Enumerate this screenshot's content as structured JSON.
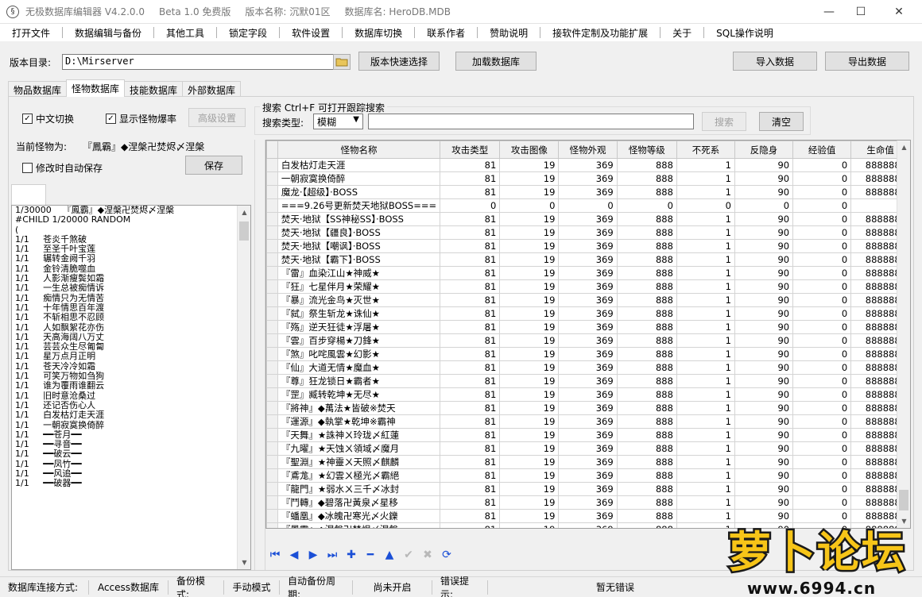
{
  "titlebar": {
    "app_name": "无极数据库编辑器 V4.2.0.0",
    "beta": "Beta 1.0 免费版",
    "version_name": "版本名称: 沉默01区",
    "db_name": "数据库名: HeroDB.MDB"
  },
  "menu": [
    "打开文件",
    "数据编辑与备份",
    "其他工具",
    "锁定字段",
    "软件设置",
    "数据库切换",
    "联系作者",
    "赞助说明",
    "接软件定制及功能扩展",
    "关于",
    "SQL操作说明"
  ],
  "toolbar": {
    "version_dir_label": "版本目录:",
    "version_dir_value": "D:\\Mirserver",
    "quick_select": "版本快速选择",
    "load_db": "加载数据库",
    "import": "导入数据",
    "export": "导出数据"
  },
  "tabs": [
    "物品数据库",
    "怪物数据库",
    "技能数据库",
    "外部数据库"
  ],
  "options": {
    "chinese_switch": "中文切换",
    "show_drop_rate": "显示怪物爆率",
    "advanced": "高级设置"
  },
  "search": {
    "title": "搜索  Ctrl+F 可打开跟踪搜索",
    "type_label": "搜索类型:",
    "type_value": "模糊",
    "query": "",
    "search_btn": "搜索",
    "clear_btn": "清空"
  },
  "current": {
    "label": "当前怪物为:",
    "name": "『鳳霸』◆涅槃卍焚烬〆涅槃",
    "autosave": "修改时自动保存",
    "save": "保存"
  },
  "droplist": [
    "",
    "1/30000    『鳳霸』◆涅槃卍焚烬〆涅槃",
    "",
    "",
    "#CHILD 1/20000 RANDOM",
    "(",
    "1/1     苍炎千煞破",
    "1/1     至圣千叶宝莲",
    "1/1     辗转金阙千羽",
    "1/1     金铃清脆噬血",
    "1/1     人影渐瘦鬓如霜",
    "1/1     一生总被痴情诉",
    "1/1     痴情只为无情苦",
    "1/1     十年情思百年渡",
    "1/1     不斩相思不忍顾",
    "1/1     人如飘絮花亦伤",
    "1/1     天高海阔八万丈",
    "1/1     芸芸众生尽匍匐",
    "1/1     星万点月正明",
    "1/1     苍天冷冷如霜",
    "1/1     可笑万物如刍狗",
    "1/1     谁为覆雨谁翻云",
    "1/1     旧时意沧桑过",
    "1/1     还记否伤心人",
    "1/1     白发枯灯走天涯",
    "1/1     一朝寂寞换倚醉",
    "1/1     ━━苍月━━",
    "1/1     ━━寻音━━",
    "1/1     ━━破云━━",
    "1/1     ━━凤竹━━",
    "1/1     ━━风追━━",
    "1/1     ━━破器━━"
  ],
  "grid": {
    "columns": [
      "怪物名称",
      "攻击类型",
      "攻击图像",
      "怪物外观",
      "怪物等级",
      "不死系",
      "反隐身",
      "经验值",
      "生命值"
    ],
    "rows": [
      [
        "白发枯灯走天涯",
        "81",
        "19",
        "369",
        "888",
        "1",
        "90",
        "0",
        "8888888"
      ],
      [
        "一朝寂寞换倚醉",
        "81",
        "19",
        "369",
        "888",
        "1",
        "90",
        "0",
        "8888888"
      ],
      [
        "魔龙·【超级】·BOSS",
        "81",
        "19",
        "369",
        "888",
        "1",
        "90",
        "0",
        "8888888"
      ],
      [
        "===9.26号更新焚天地狱BOSS===",
        "0",
        "0",
        "0",
        "0",
        "0",
        "0",
        "0",
        ""
      ],
      [
        "焚天·地狱【SS神秘SS】·BOSS",
        "81",
        "19",
        "369",
        "888",
        "1",
        "90",
        "0",
        "8888888"
      ],
      [
        "焚天·地狱【疆良】·BOSS",
        "81",
        "19",
        "369",
        "888",
        "1",
        "90",
        "0",
        "8888888"
      ],
      [
        "焚天·地狱【嘲讽】·BOSS",
        "81",
        "19",
        "369",
        "888",
        "1",
        "90",
        "0",
        "8888888"
      ],
      [
        "焚天·地狱【霸下】·BOSS",
        "81",
        "19",
        "369",
        "888",
        "1",
        "90",
        "0",
        "8888888"
      ],
      [
        "『雷』血染江山★神威★",
        "81",
        "19",
        "369",
        "888",
        "1",
        "90",
        "0",
        "8888888"
      ],
      [
        "『狂』七星伴月★荣耀★",
        "81",
        "19",
        "369",
        "888",
        "1",
        "90",
        "0",
        "8888888"
      ],
      [
        "『暴』流光金鸟★灭世★",
        "81",
        "19",
        "369",
        "888",
        "1",
        "90",
        "0",
        "8888888"
      ],
      [
        "『弑』祭生斩龙★诛仙★",
        "81",
        "19",
        "369",
        "888",
        "1",
        "90",
        "0",
        "8888888"
      ],
      [
        "『殇』逆天狂徒★浮屠★",
        "81",
        "19",
        "369",
        "888",
        "1",
        "90",
        "0",
        "8888888"
      ],
      [
        "『雲』百步穿楊★刀鋒★",
        "81",
        "19",
        "369",
        "888",
        "1",
        "90",
        "0",
        "8888888"
      ],
      [
        "『煞』叱咤風雲★幻影★",
        "81",
        "19",
        "369",
        "888",
        "1",
        "90",
        "0",
        "8888888"
      ],
      [
        "『仙』大道无情★魔血★",
        "81",
        "19",
        "369",
        "888",
        "1",
        "90",
        "0",
        "8888888"
      ],
      [
        "『尊』狂龙锁日★霸者★",
        "81",
        "19",
        "369",
        "888",
        "1",
        "90",
        "0",
        "8888888"
      ],
      [
        "『罡』臧转乾坤★无尽★",
        "81",
        "19",
        "369",
        "888",
        "1",
        "90",
        "0",
        "8888888"
      ],
      [
        "『將神』◆萬法★皆破※焚天",
        "81",
        "19",
        "369",
        "888",
        "1",
        "90",
        "0",
        "8888888"
      ],
      [
        "『運源』◆執掌★乾坤※霸神",
        "81",
        "19",
        "369",
        "888",
        "1",
        "90",
        "0",
        "8888888"
      ],
      [
        "『天舞』★誅神ㄨ玲珑〆紅蓮",
        "81",
        "19",
        "369",
        "888",
        "1",
        "90",
        "0",
        "8888888"
      ],
      [
        "『九曜』★天蚀ㄨ領域〆魔月",
        "81",
        "19",
        "369",
        "888",
        "1",
        "90",
        "0",
        "8888888"
      ],
      [
        "『聖淵』★神靈ㄨ天照〆麒麟",
        "81",
        "19",
        "369",
        "888",
        "1",
        "90",
        "0",
        "8888888"
      ],
      [
        "『鳶尨』★幻雲ㄨ極光〆霸絕",
        "81",
        "19",
        "369",
        "888",
        "1",
        "90",
        "0",
        "8888888"
      ],
      [
        "『龍門』★弱水ㄨ三千〆冰封",
        "81",
        "19",
        "369",
        "888",
        "1",
        "90",
        "0",
        "8888888"
      ],
      [
        "『鬥轉』◆碧落卍黃泉〆星移",
        "81",
        "19",
        "369",
        "888",
        "1",
        "90",
        "0",
        "8888888"
      ],
      [
        "『蟠凰』◆冰魄卍寒光〆火鑠",
        "81",
        "19",
        "369",
        "888",
        "1",
        "90",
        "0",
        "8888888"
      ],
      [
        "『鳳霸』◆涅槃卍焚烬〆涅槃",
        "81",
        "19",
        "369",
        "888",
        "1",
        "90",
        "0",
        "8888888"
      ]
    ],
    "current_row": 27
  },
  "statusbar": {
    "conn_label": "数据库连接方式:",
    "conn_value": "Access数据库",
    "backup_label": "备份模式:",
    "backup_value": "手动模式",
    "auto_label": "自动备份周期:",
    "auto_value": "尚未开启",
    "err_label": "错误提示:",
    "err_value": "暂无错误"
  },
  "watermark": {
    "text": "萝卜论坛",
    "url": "www.6994.cn"
  }
}
